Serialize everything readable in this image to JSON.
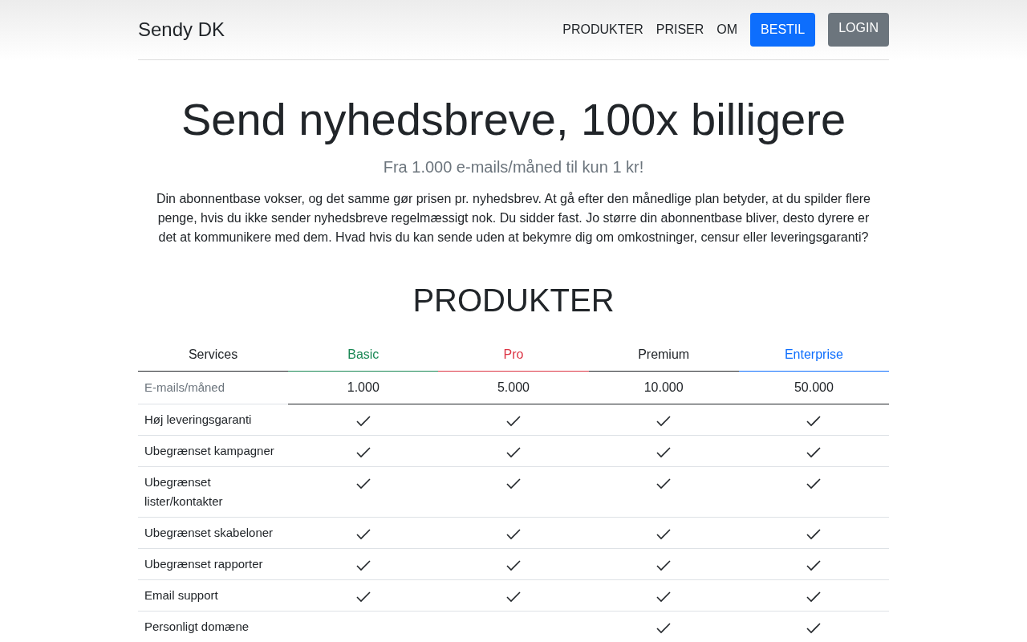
{
  "header": {
    "brand": "Sendy DK",
    "nav": [
      {
        "label": "PRODUKTER",
        "kind": "link"
      },
      {
        "label": "PRISER",
        "kind": "link"
      },
      {
        "label": "OM",
        "kind": "link"
      },
      {
        "label": "BESTIL",
        "kind": "primary"
      },
      {
        "label": "LOGIN",
        "kind": "secondary"
      }
    ]
  },
  "hero": {
    "title": "Send nyhedsbreve, 100x billigere",
    "subtitle": "Fra 1.000 e-mails/måned til kun 1 kr!",
    "text": "Din abonnentbase vokser, og det samme gør prisen pr. nyhedsbrev. At gå efter den månedlige plan betyder, at du spilder flere penge, hvis du ikke sender nyhedsbreve regelmæssigt nok. Du sidder fast. Jo større din abonnentbase bliver, desto dyrere er det at kommunikere med dem. Hvad hvis du kan sende uden at bekymre dig om omkostninger, censur eller leveringsgaranti?"
  },
  "products": {
    "heading": "PRODUKTER",
    "first_column": "Services",
    "plans": [
      {
        "name": "Basic",
        "color": "#198754"
      },
      {
        "name": "Pro",
        "color": "#dc3545"
      },
      {
        "name": "Premium",
        "color": "#212529"
      },
      {
        "name": "Enterprise",
        "color": "#0d6efd"
      }
    ],
    "volume_row": {
      "label": "E-mails/måned",
      "values": [
        "1.000",
        "5.000",
        "10.000",
        "50.000"
      ]
    },
    "rows": [
      {
        "service": "Høj leveringsgaranti",
        "included": [
          true,
          true,
          true,
          true
        ]
      },
      {
        "service": "Ubegrænset kampagner",
        "included": [
          true,
          true,
          true,
          true
        ]
      },
      {
        "service": "Ubegrænset lister/kontakter",
        "included": [
          true,
          true,
          true,
          true
        ]
      },
      {
        "service": "Ubegrænset skabeloner",
        "included": [
          true,
          true,
          true,
          true
        ]
      },
      {
        "service": "Ubegrænset rapporter",
        "included": [
          true,
          true,
          true,
          true
        ]
      },
      {
        "service": "Email support",
        "included": [
          true,
          true,
          true,
          true
        ]
      },
      {
        "service": "Personligt domæne",
        "included": [
          false,
          false,
          true,
          true
        ]
      }
    ]
  }
}
